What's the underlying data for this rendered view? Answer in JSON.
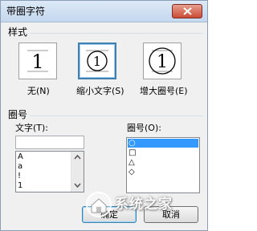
{
  "window": {
    "title": "带圈字符",
    "close_icon": "close-x-icon"
  },
  "style_group": {
    "title": "样式",
    "options": [
      {
        "label": "无(N)",
        "sample": "1",
        "selected": false
      },
      {
        "label": "缩小文字(S)",
        "sample": "①",
        "selected": true
      },
      {
        "label": "增大圈号(E)",
        "sample": "1",
        "selected": false
      }
    ]
  },
  "enclosure_group": {
    "title": "圈号",
    "text_label": "文字(T):",
    "text_value": "",
    "text_items": [
      "A",
      "a",
      "!",
      "1"
    ],
    "enclosure_label": "圈号(O):",
    "enclosure_items": [
      "○",
      "□",
      "△",
      "◇"
    ],
    "enclosure_selected_index": 0
  },
  "buttons": {
    "ok_label": "确定",
    "cancel_label": "取消"
  },
  "watermark": {
    "text": "系统之家",
    "icon": "system-home-logo-icon"
  },
  "colors": {
    "selection": "#3399ff",
    "selected_border": "#3c7fb1",
    "titlebar": "#c4d7ee",
    "close_button": "#c94b35"
  }
}
